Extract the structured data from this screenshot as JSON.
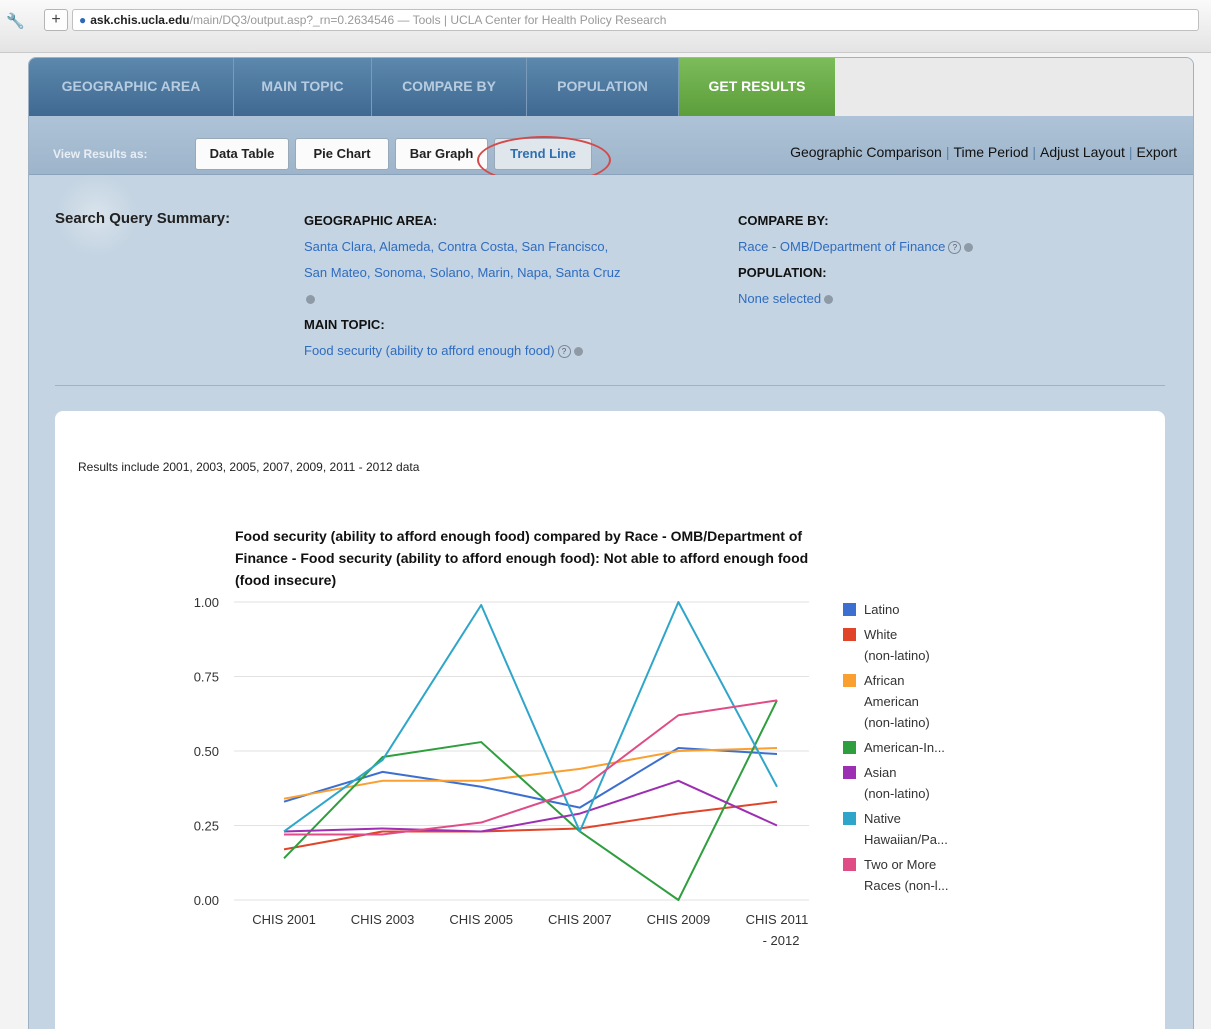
{
  "browser": {
    "host": "ask.chis.ucla.edu",
    "path": "/main/DQ3/output.asp?_rn=0.2634546 — Tools | UCLA Center for Health Policy Research"
  },
  "steps": [
    {
      "label": "GEOGRAPHIC AREA",
      "active": false
    },
    {
      "label": "MAIN TOPIC",
      "active": false
    },
    {
      "label": "COMPARE BY",
      "active": false
    },
    {
      "label": "POPULATION",
      "active": false
    },
    {
      "label": "GET RESULTS",
      "active": true
    }
  ],
  "view_results": {
    "label": "View Results as:",
    "tabs": [
      "Data Table",
      "Pie Chart",
      "Bar Graph",
      "Trend Line"
    ],
    "selected": "Trend Line",
    "links": [
      "Geographic Comparison",
      "Time Period",
      "Adjust Layout",
      "Export"
    ]
  },
  "summary": {
    "label": "Search Query Summary:",
    "geo_heading": "GEOGRAPHIC AREA:",
    "geo_line1": "Santa Clara, Alameda, Contra Costa, San Francisco,",
    "geo_line2": "San Mateo, Sonoma, Solano, Marin, Napa, Santa Cruz",
    "topic_heading": "MAIN TOPIC:",
    "topic_value": "Food security (ability to afford enough food)",
    "compare_heading": "COMPARE BY:",
    "compare_value": "Race - OMB/Department of Finance",
    "population_heading": "POPULATION:",
    "population_value": "None selected"
  },
  "results_note": "Results include 2001, 2003, 2005, 2007, 2009, 2011 - 2012 data",
  "chart_data": {
    "type": "line",
    "title": "Food security (ability to afford enough food) compared by Race - OMB/Department of Finance - Food security (ability to afford enough food): Not able to afford enough food (food insecure)",
    "categories": [
      "CHIS 2001",
      "CHIS 2003",
      "CHIS 2005",
      "CHIS 2007",
      "CHIS 2009",
      "CHIS 2011 - 2012"
    ],
    "yticks": [
      "1.00",
      "0.75",
      "0.50",
      "0.25",
      "0.00"
    ],
    "ylim": [
      0,
      1
    ],
    "grid": true,
    "legend_position": "right",
    "series": [
      {
        "name": "Latino",
        "color": "#3d6fd1",
        "values": [
          0.33,
          0.43,
          0.38,
          0.31,
          0.51,
          0.49
        ]
      },
      {
        "name": "White (non-latino)",
        "color": "#e0452a",
        "values": [
          0.17,
          0.23,
          0.23,
          0.24,
          0.29,
          0.33
        ]
      },
      {
        "name": "African American (non-latino)",
        "color": "#f9a030",
        "values": [
          0.34,
          0.4,
          0.4,
          0.44,
          0.5,
          0.51
        ]
      },
      {
        "name": "American-In...",
        "color": "#2e9e3e",
        "values": [
          0.14,
          0.48,
          0.53,
          0.23,
          0.0,
          0.67
        ]
      },
      {
        "name": "Asian (non-latino)",
        "color": "#9c2fb2",
        "values": [
          0.23,
          0.24,
          0.23,
          0.29,
          0.4,
          0.25
        ]
      },
      {
        "name": "Native Hawaiian/Pa...",
        "color": "#2fa6c9",
        "values": [
          0.23,
          0.47,
          0.99,
          0.23,
          1.0,
          0.38
        ]
      },
      {
        "name": "Two or More Races (non-l...",
        "color": "#e04c86",
        "values": [
          0.22,
          0.22,
          0.26,
          0.37,
          0.62,
          0.67
        ]
      }
    ]
  }
}
